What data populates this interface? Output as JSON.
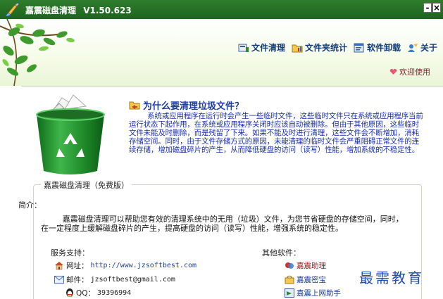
{
  "window": {
    "title": "嘉震磁盘清理",
    "version": "V1.50.623",
    "minimize_label": "-",
    "close_label": "×"
  },
  "toolbar": {
    "items": [
      {
        "label": "文件清理",
        "icon": "file-clean-icon"
      },
      {
        "label": "文件夹统计",
        "icon": "folder-stats-icon"
      },
      {
        "label": "软件卸载",
        "icon": "uninstall-icon"
      },
      {
        "label": "关于",
        "icon": "about-icon"
      }
    ]
  },
  "welcome": "欢迎使用",
  "why": {
    "title": "为什么要清理垃圾文件？",
    "body": "系统或应用程序在运行时会产生一些临时文件，这些临时文件只在系统或应用程序当前运行状态下起作用，在系统或应用程序关闭时应该自动被删除。但由于其他原因，这些临时文件未能及时删除，而是残留了下来。如果不能及时进行清理，这些文件会不断增加，消耗存储空间。同时，由于文件存储方式的原因，未能清理的临时文件会严重阻碍正常文件的连续存储，增加磁盘碎片的产生，从而降低硬盘的访问（读写）性能，增加系统的不稳定性。"
  },
  "group": {
    "legend": "嘉震磁盘清理（免费版）",
    "intro_title": "简介：",
    "intro_body": "嘉震磁盘清理可以帮助您有效的清理系统中的无用（垃圾）文件，为您节省硬盘的存储空间，同时，在一定程度上缓解磁盘碎片的产生，提高硬盘的访问（读写）性能，增强系统的稳定性。",
    "service_title": "服务支持：",
    "website_label": "网址：",
    "website_value": "http://www.jzsoftbest.com",
    "email_label": "邮件：",
    "email_value": "jzsoftbest@gmail.com",
    "qq_label": "QQ：",
    "qq_value": "39396994",
    "other_title": "其他软件：",
    "other_items": [
      "嘉震助理",
      "嘉震密宝",
      "嘉震上网助手"
    ]
  },
  "watermark": "最需教育",
  "colors": {
    "titlebar": "#1d6420",
    "body_text_blue": "#1a2fa8",
    "trash_green": "#1f8a2a"
  }
}
